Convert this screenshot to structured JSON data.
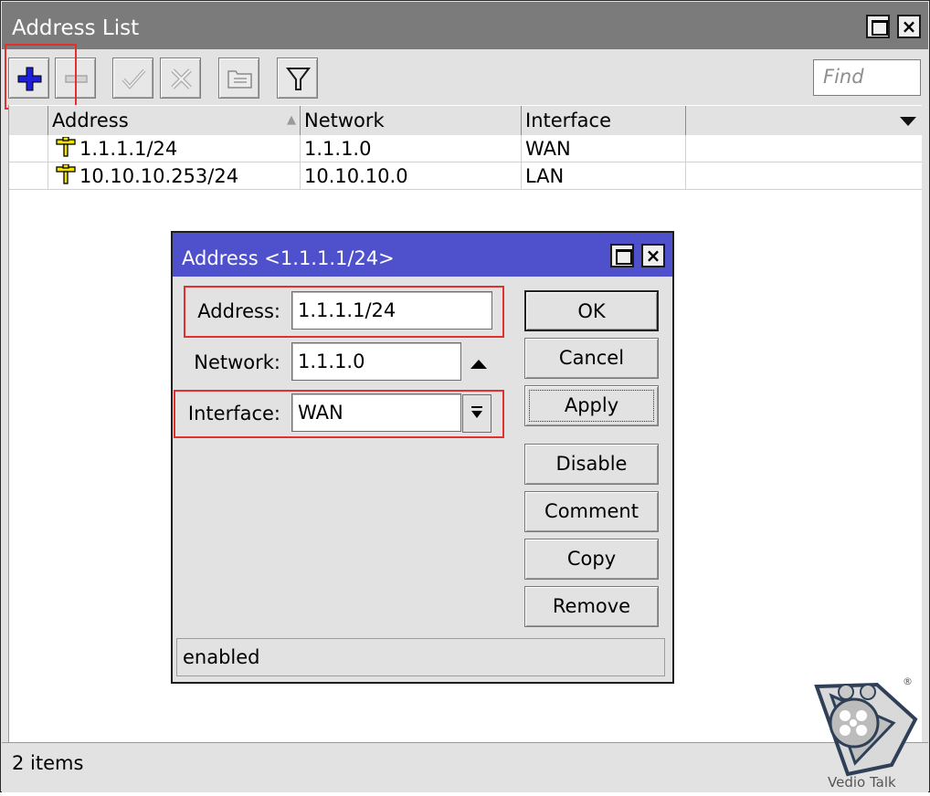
{
  "window": {
    "title": "Address List",
    "maximize_icon": "maximize-icon",
    "close_icon": "close-icon",
    "close_glyph": "×"
  },
  "toolbar": {
    "buttons": [
      {
        "name": "add-button",
        "icon": "plus-icon"
      },
      {
        "name": "remove-button",
        "icon": "minus-icon"
      },
      {
        "name": "enable-button",
        "icon": "check-icon"
      },
      {
        "name": "disable-button",
        "icon": "x-icon"
      },
      {
        "name": "comment-button",
        "icon": "note-icon"
      },
      {
        "name": "filter-button",
        "icon": "funnel-icon"
      }
    ],
    "find_placeholder": "Find"
  },
  "table": {
    "columns": [
      "Address",
      "Network",
      "Interface"
    ],
    "sort_indicator": "▲",
    "rows": [
      {
        "address": "1.1.1.1/24",
        "network": "1.1.1.0",
        "interface": "WAN"
      },
      {
        "address": "10.10.10.253/24",
        "network": "10.10.10.0",
        "interface": "LAN"
      }
    ]
  },
  "statusbar": {
    "count": "2 items"
  },
  "dialog": {
    "title": "Address <1.1.1.1/24>",
    "close_glyph": "×",
    "fields": {
      "address_label": "Address:",
      "address_value": "1.1.1.1/24",
      "network_label": "Network:",
      "network_value": "1.1.1.0",
      "interface_label": "Interface:",
      "interface_value": "WAN"
    },
    "buttons": {
      "ok": "OK",
      "cancel": "Cancel",
      "apply": "Apply",
      "disable": "Disable",
      "comment": "Comment",
      "copy": "Copy",
      "remove": "Remove"
    },
    "status": "enabled"
  },
  "watermark": {
    "text": "Vedio Talk",
    "registered": "®"
  },
  "colors": {
    "title_bar": "#7b7b7b",
    "dialog_title_bar": "#4e50cc",
    "highlight_box": "#e03030",
    "add_icon": "#1f1fd8",
    "address_icon": "#f3e400"
  }
}
